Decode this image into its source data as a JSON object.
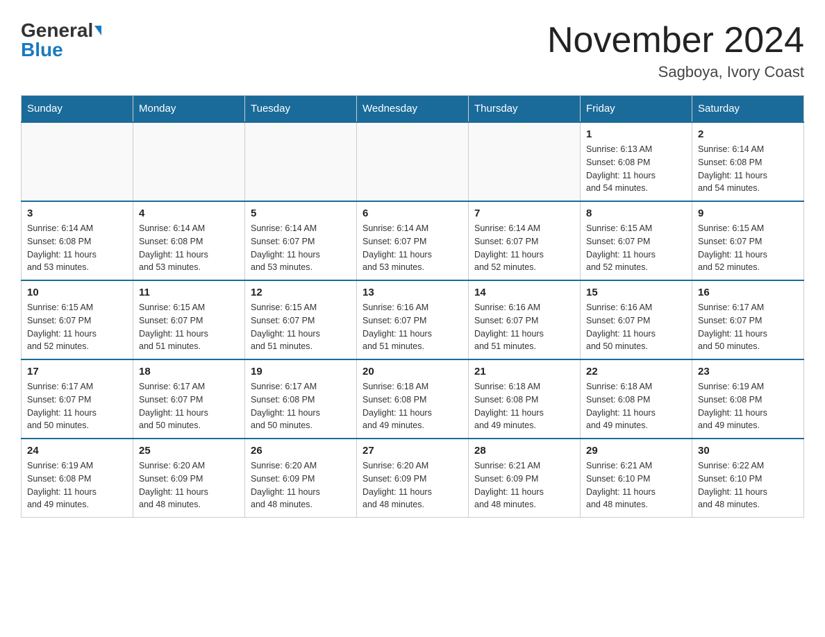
{
  "header": {
    "logo_general": "General",
    "logo_blue": "Blue",
    "month_title": "November 2024",
    "location": "Sagboya, Ivory Coast"
  },
  "days_of_week": [
    "Sunday",
    "Monday",
    "Tuesday",
    "Wednesday",
    "Thursday",
    "Friday",
    "Saturday"
  ],
  "weeks": [
    [
      {
        "day": "",
        "info": ""
      },
      {
        "day": "",
        "info": ""
      },
      {
        "day": "",
        "info": ""
      },
      {
        "day": "",
        "info": ""
      },
      {
        "day": "",
        "info": ""
      },
      {
        "day": "1",
        "info": "Sunrise: 6:13 AM\nSunset: 6:08 PM\nDaylight: 11 hours\nand 54 minutes."
      },
      {
        "day": "2",
        "info": "Sunrise: 6:14 AM\nSunset: 6:08 PM\nDaylight: 11 hours\nand 54 minutes."
      }
    ],
    [
      {
        "day": "3",
        "info": "Sunrise: 6:14 AM\nSunset: 6:08 PM\nDaylight: 11 hours\nand 53 minutes."
      },
      {
        "day": "4",
        "info": "Sunrise: 6:14 AM\nSunset: 6:08 PM\nDaylight: 11 hours\nand 53 minutes."
      },
      {
        "day": "5",
        "info": "Sunrise: 6:14 AM\nSunset: 6:07 PM\nDaylight: 11 hours\nand 53 minutes."
      },
      {
        "day": "6",
        "info": "Sunrise: 6:14 AM\nSunset: 6:07 PM\nDaylight: 11 hours\nand 53 minutes."
      },
      {
        "day": "7",
        "info": "Sunrise: 6:14 AM\nSunset: 6:07 PM\nDaylight: 11 hours\nand 52 minutes."
      },
      {
        "day": "8",
        "info": "Sunrise: 6:15 AM\nSunset: 6:07 PM\nDaylight: 11 hours\nand 52 minutes."
      },
      {
        "day": "9",
        "info": "Sunrise: 6:15 AM\nSunset: 6:07 PM\nDaylight: 11 hours\nand 52 minutes."
      }
    ],
    [
      {
        "day": "10",
        "info": "Sunrise: 6:15 AM\nSunset: 6:07 PM\nDaylight: 11 hours\nand 52 minutes."
      },
      {
        "day": "11",
        "info": "Sunrise: 6:15 AM\nSunset: 6:07 PM\nDaylight: 11 hours\nand 51 minutes."
      },
      {
        "day": "12",
        "info": "Sunrise: 6:15 AM\nSunset: 6:07 PM\nDaylight: 11 hours\nand 51 minutes."
      },
      {
        "day": "13",
        "info": "Sunrise: 6:16 AM\nSunset: 6:07 PM\nDaylight: 11 hours\nand 51 minutes."
      },
      {
        "day": "14",
        "info": "Sunrise: 6:16 AM\nSunset: 6:07 PM\nDaylight: 11 hours\nand 51 minutes."
      },
      {
        "day": "15",
        "info": "Sunrise: 6:16 AM\nSunset: 6:07 PM\nDaylight: 11 hours\nand 50 minutes."
      },
      {
        "day": "16",
        "info": "Sunrise: 6:17 AM\nSunset: 6:07 PM\nDaylight: 11 hours\nand 50 minutes."
      }
    ],
    [
      {
        "day": "17",
        "info": "Sunrise: 6:17 AM\nSunset: 6:07 PM\nDaylight: 11 hours\nand 50 minutes."
      },
      {
        "day": "18",
        "info": "Sunrise: 6:17 AM\nSunset: 6:07 PM\nDaylight: 11 hours\nand 50 minutes."
      },
      {
        "day": "19",
        "info": "Sunrise: 6:17 AM\nSunset: 6:08 PM\nDaylight: 11 hours\nand 50 minutes."
      },
      {
        "day": "20",
        "info": "Sunrise: 6:18 AM\nSunset: 6:08 PM\nDaylight: 11 hours\nand 49 minutes."
      },
      {
        "day": "21",
        "info": "Sunrise: 6:18 AM\nSunset: 6:08 PM\nDaylight: 11 hours\nand 49 minutes."
      },
      {
        "day": "22",
        "info": "Sunrise: 6:18 AM\nSunset: 6:08 PM\nDaylight: 11 hours\nand 49 minutes."
      },
      {
        "day": "23",
        "info": "Sunrise: 6:19 AM\nSunset: 6:08 PM\nDaylight: 11 hours\nand 49 minutes."
      }
    ],
    [
      {
        "day": "24",
        "info": "Sunrise: 6:19 AM\nSunset: 6:08 PM\nDaylight: 11 hours\nand 49 minutes."
      },
      {
        "day": "25",
        "info": "Sunrise: 6:20 AM\nSunset: 6:09 PM\nDaylight: 11 hours\nand 48 minutes."
      },
      {
        "day": "26",
        "info": "Sunrise: 6:20 AM\nSunset: 6:09 PM\nDaylight: 11 hours\nand 48 minutes."
      },
      {
        "day": "27",
        "info": "Sunrise: 6:20 AM\nSunset: 6:09 PM\nDaylight: 11 hours\nand 48 minutes."
      },
      {
        "day": "28",
        "info": "Sunrise: 6:21 AM\nSunset: 6:09 PM\nDaylight: 11 hours\nand 48 minutes."
      },
      {
        "day": "29",
        "info": "Sunrise: 6:21 AM\nSunset: 6:10 PM\nDaylight: 11 hours\nand 48 minutes."
      },
      {
        "day": "30",
        "info": "Sunrise: 6:22 AM\nSunset: 6:10 PM\nDaylight: 11 hours\nand 48 minutes."
      }
    ]
  ]
}
